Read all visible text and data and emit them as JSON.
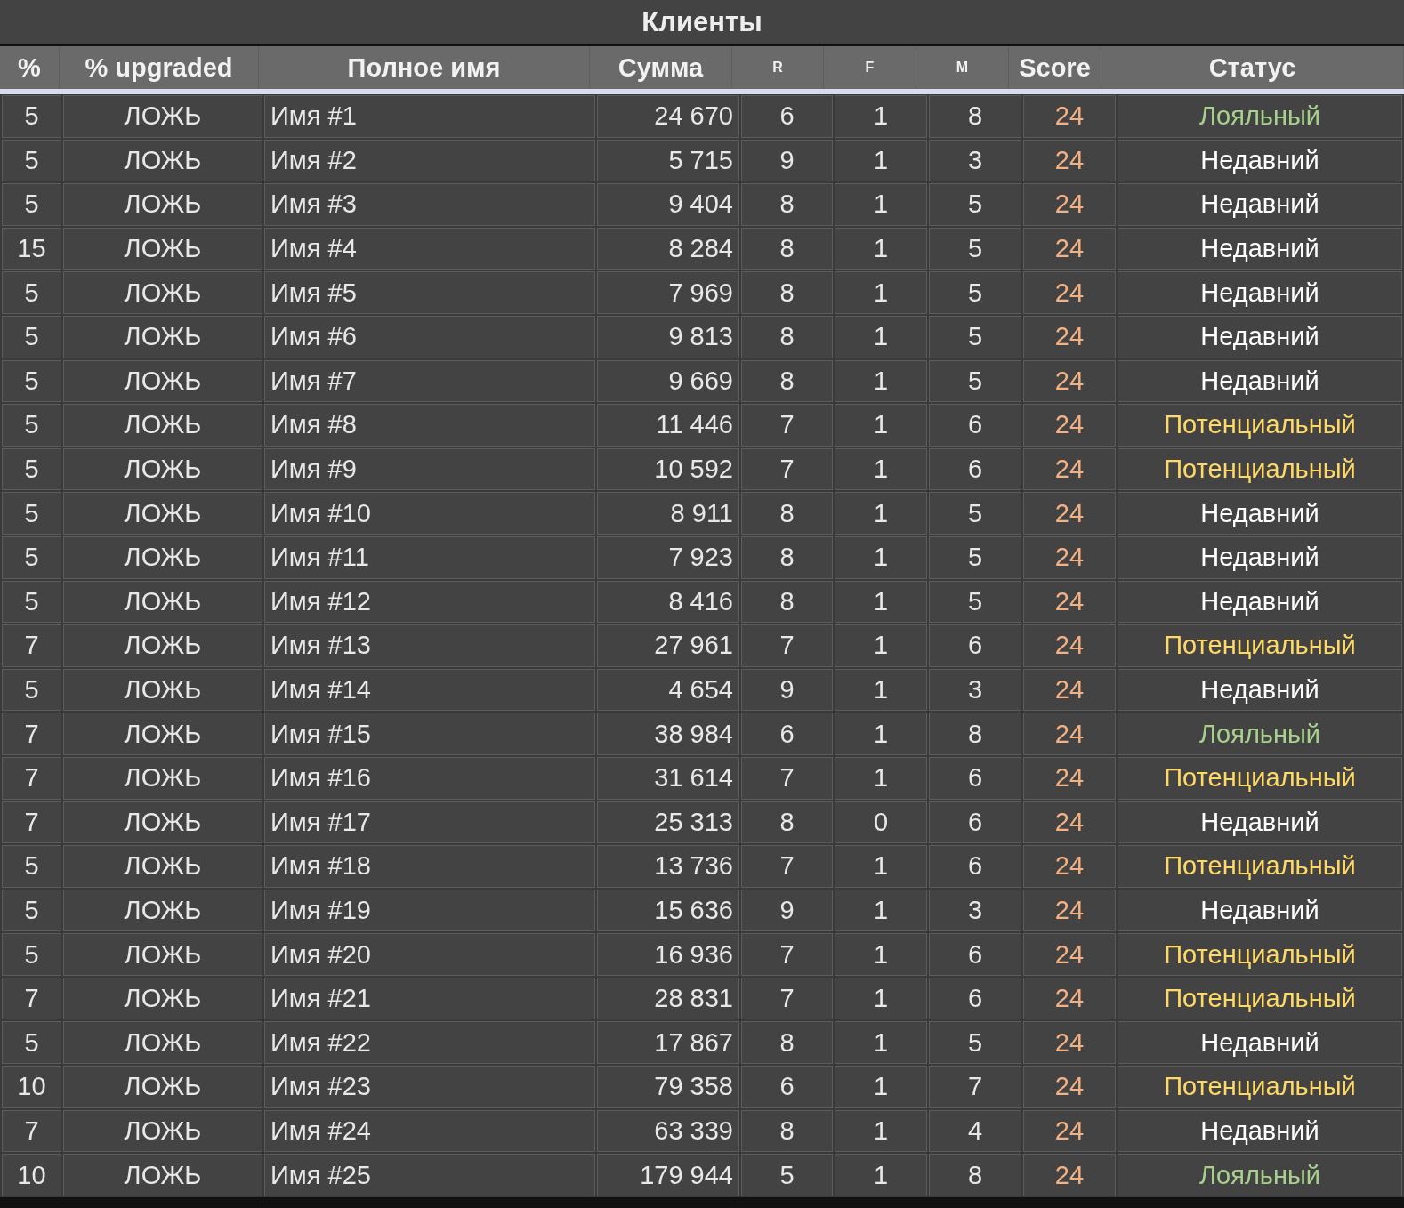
{
  "title": "Клиенты",
  "columns": [
    {
      "label": "%",
      "kind": "big"
    },
    {
      "label": "% upgraded",
      "kind": "big"
    },
    {
      "label": "Полное имя",
      "kind": "big"
    },
    {
      "label": "Сумма",
      "kind": "big"
    },
    {
      "label": "R",
      "kind": "small"
    },
    {
      "label": "F",
      "kind": "small"
    },
    {
      "label": "M",
      "kind": "small"
    },
    {
      "label": "Score",
      "kind": "big",
      "color": "#f4b183"
    },
    {
      "label": "Статус",
      "kind": "big"
    }
  ],
  "rows": [
    {
      "pct": "5",
      "upgraded": "ЛОЖЬ",
      "name": "Имя #1",
      "sum": "24 670",
      "r": "6",
      "f": "1",
      "m": "8",
      "score": "24",
      "status": "Лояльный",
      "color": "#a9d18e"
    },
    {
      "pct": "5",
      "upgraded": "ЛОЖЬ",
      "name": "Имя #2",
      "sum": "5 715",
      "r": "9",
      "f": "1",
      "m": "3",
      "score": "24",
      "status": "Недавний",
      "color": "#ffffff"
    },
    {
      "pct": "5",
      "upgraded": "ЛОЖЬ",
      "name": "Имя #3",
      "sum": "9 404",
      "r": "8",
      "f": "1",
      "m": "5",
      "score": "24",
      "status": "Недавний",
      "color": "#ffffff"
    },
    {
      "pct": "15",
      "upgraded": "ЛОЖЬ",
      "name": "Имя #4",
      "sum": "8 284",
      "r": "8",
      "f": "1",
      "m": "5",
      "score": "24",
      "status": "Недавний",
      "color": "#ffffff"
    },
    {
      "pct": "5",
      "upgraded": "ЛОЖЬ",
      "name": "Имя #5",
      "sum": "7 969",
      "r": "8",
      "f": "1",
      "m": "5",
      "score": "24",
      "status": "Недавний",
      "color": "#ffffff"
    },
    {
      "pct": "5",
      "upgraded": "ЛОЖЬ",
      "name": "Имя #6",
      "sum": "9 813",
      "r": "8",
      "f": "1",
      "m": "5",
      "score": "24",
      "status": "Недавний",
      "color": "#ffffff"
    },
    {
      "pct": "5",
      "upgraded": "ЛОЖЬ",
      "name": "Имя #7",
      "sum": "9 669",
      "r": "8",
      "f": "1",
      "m": "5",
      "score": "24",
      "status": "Недавний",
      "color": "#ffffff"
    },
    {
      "pct": "5",
      "upgraded": "ЛОЖЬ",
      "name": "Имя #8",
      "sum": "11 446",
      "r": "7",
      "f": "1",
      "m": "6",
      "score": "24",
      "status": "Потенциальный",
      "color": "#ffd966"
    },
    {
      "pct": "5",
      "upgraded": "ЛОЖЬ",
      "name": "Имя #9",
      "sum": "10 592",
      "r": "7",
      "f": "1",
      "m": "6",
      "score": "24",
      "status": "Потенциальный",
      "color": "#ffd966"
    },
    {
      "pct": "5",
      "upgraded": "ЛОЖЬ",
      "name": "Имя #10",
      "sum": "8 911",
      "r": "8",
      "f": "1",
      "m": "5",
      "score": "24",
      "status": "Недавний",
      "color": "#ffffff"
    },
    {
      "pct": "5",
      "upgraded": "ЛОЖЬ",
      "name": "Имя #11",
      "sum": "7 923",
      "r": "8",
      "f": "1",
      "m": "5",
      "score": "24",
      "status": "Недавний",
      "color": "#ffffff"
    },
    {
      "pct": "5",
      "upgraded": "ЛОЖЬ",
      "name": "Имя #12",
      "sum": "8 416",
      "r": "8",
      "f": "1",
      "m": "5",
      "score": "24",
      "status": "Недавний",
      "color": "#ffffff"
    },
    {
      "pct": "7",
      "upgraded": "ЛОЖЬ",
      "name": "Имя #13",
      "sum": "27 961",
      "r": "7",
      "f": "1",
      "m": "6",
      "score": "24",
      "status": "Потенциальный",
      "color": "#ffd966"
    },
    {
      "pct": "5",
      "upgraded": "ЛОЖЬ",
      "name": "Имя #14",
      "sum": "4 654",
      "r": "9",
      "f": "1",
      "m": "3",
      "score": "24",
      "status": "Недавний",
      "color": "#ffffff"
    },
    {
      "pct": "7",
      "upgraded": "ЛОЖЬ",
      "name": "Имя #15",
      "sum": "38 984",
      "r": "6",
      "f": "1",
      "m": "8",
      "score": "24",
      "status": "Лояльный",
      "color": "#a9d18e"
    },
    {
      "pct": "7",
      "upgraded": "ЛОЖЬ",
      "name": "Имя #16",
      "sum": "31 614",
      "r": "7",
      "f": "1",
      "m": "6",
      "score": "24",
      "status": "Потенциальный",
      "color": "#ffd966"
    },
    {
      "pct": "7",
      "upgraded": "ЛОЖЬ",
      "name": "Имя #17",
      "sum": "25 313",
      "r": "8",
      "f": "0",
      "m": "6",
      "score": "24",
      "status": "Недавний",
      "color": "#ffffff"
    },
    {
      "pct": "5",
      "upgraded": "ЛОЖЬ",
      "name": "Имя #18",
      "sum": "13 736",
      "r": "7",
      "f": "1",
      "m": "6",
      "score": "24",
      "status": "Потенциальный",
      "color": "#ffd966"
    },
    {
      "pct": "5",
      "upgraded": "ЛОЖЬ",
      "name": "Имя #19",
      "sum": "15 636",
      "r": "9",
      "f": "1",
      "m": "3",
      "score": "24",
      "status": "Недавний",
      "color": "#ffffff"
    },
    {
      "pct": "5",
      "upgraded": "ЛОЖЬ",
      "name": "Имя #20",
      "sum": "16 936",
      "r": "7",
      "f": "1",
      "m": "6",
      "score": "24",
      "status": "Потенциальный",
      "color": "#ffd966"
    },
    {
      "pct": "7",
      "upgraded": "ЛОЖЬ",
      "name": "Имя #21",
      "sum": "28 831",
      "r": "7",
      "f": "1",
      "m": "6",
      "score": "24",
      "status": "Потенциальный",
      "color": "#ffd966"
    },
    {
      "pct": "5",
      "upgraded": "ЛОЖЬ",
      "name": "Имя #22",
      "sum": "17 867",
      "r": "8",
      "f": "1",
      "m": "5",
      "score": "24",
      "status": "Недавний",
      "color": "#ffffff"
    },
    {
      "pct": "10",
      "upgraded": "ЛОЖЬ",
      "name": "Имя #23",
      "sum": "79 358",
      "r": "6",
      "f": "1",
      "m": "7",
      "score": "24",
      "status": "Потенциальный",
      "color": "#ffd966"
    },
    {
      "pct": "7",
      "upgraded": "ЛОЖЬ",
      "name": "Имя #24",
      "sum": "63 339",
      "r": "8",
      "f": "1",
      "m": "4",
      "score": "24",
      "status": "Недавний",
      "color": "#ffffff"
    },
    {
      "pct": "10",
      "upgraded": "ЛОЖЬ",
      "name": "Имя #25",
      "sum": "179 944",
      "r": "5",
      "f": "1",
      "m": "8",
      "score": "24",
      "status": "Лояльный",
      "color": "#a9d18e"
    }
  ]
}
